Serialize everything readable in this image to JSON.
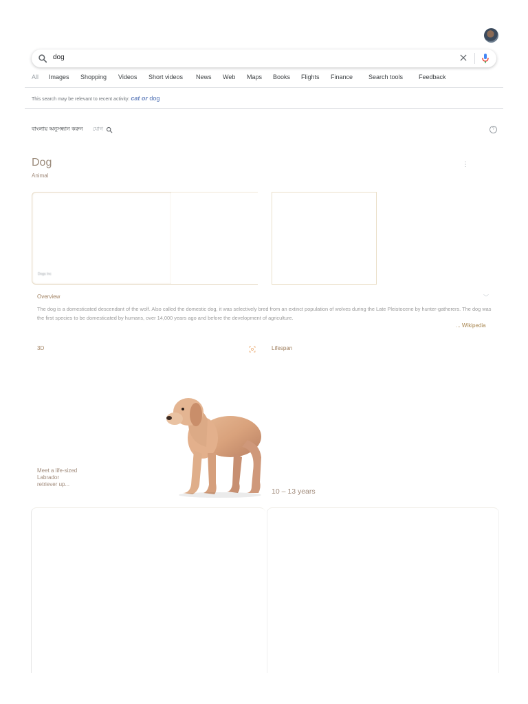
{
  "search": {
    "query": "dog"
  },
  "tabs": [
    "All",
    "Images",
    "Shopping",
    "Videos",
    "Short videos",
    "News",
    "Web",
    "Maps",
    "Books",
    "Flights",
    "Finance",
    "Search tools",
    "Feedback"
  ],
  "notice": {
    "prefix": "This search may be relevant to recent activity:",
    "cat": "cat",
    "or": "or",
    "dog": "dog"
  },
  "translate": {
    "label": "বাংলায় অনুসন্ধান করুন",
    "word": "যোগ"
  },
  "knowledge_panel": {
    "title": "Dog",
    "subtitle": "Animal",
    "image_caption": "Dogs Inc",
    "overview": {
      "heading": "Overview",
      "text": "The dog is a domesticated descendant of the wolf. Also called the domestic dog, it was selectively bred from an extinct population of wolves during the Late Pleistocene by hunter-gatherers. The dog was the first species to be domesticated by humans, over 14,000 years ago and before the development of agriculture.",
      "source": "... Wikipedia"
    },
    "view3d": {
      "heading": "3D",
      "description": "Meet a life-sized Labrador retriever up..."
    },
    "lifespan": {
      "heading": "Lifespan",
      "value": "10 – 13 years"
    }
  },
  "icons": {
    "search": "search-icon",
    "clear": "close-icon",
    "mic": "microphone-icon",
    "help": "help-icon",
    "menu": "more-vert-icon",
    "ar": "view-in-3d-icon",
    "chevron": "chevron-down-icon"
  },
  "colors": {
    "accent": "#a08060",
    "link": "#4d6fb3",
    "mic_blue": "#4285f4",
    "mic_red": "#ea4335"
  }
}
